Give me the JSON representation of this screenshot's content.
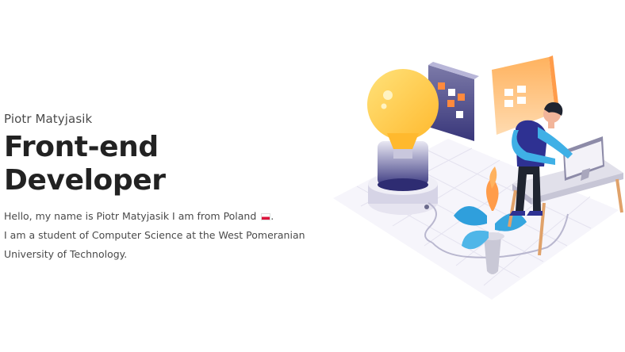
{
  "hero": {
    "name": "Piotr Matyjasik",
    "title": "Front-end Developer",
    "bio_line1_prefix": "Hello, my name is Piotr Matyjasik I am from Poland",
    "bio_line1_suffix": ".",
    "bio_line2": "I am a student of Computer Science at the West Pomeranian",
    "bio_line3": "University of Technology."
  },
  "colors": {
    "text_dark": "#222222",
    "text_muted": "#4a4a4a",
    "bulb_yellow": "#ffc93c",
    "accent_orange": "#ff9c4a",
    "accent_blue": "#2f9fdc",
    "navy": "#2e3192"
  },
  "icons": {
    "flag": "poland-flag-icon",
    "illustration": "developer-illustration"
  }
}
